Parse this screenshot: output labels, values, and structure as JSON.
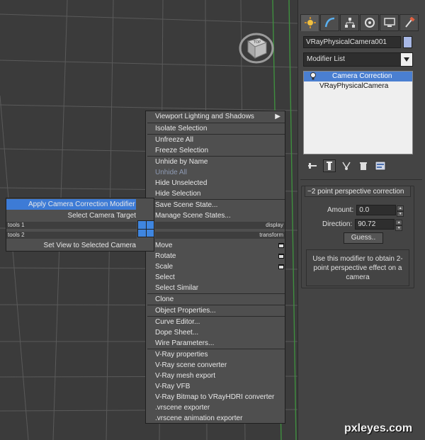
{
  "panel": {
    "object_name": "VRayPhysicalCamera001",
    "modifier_list": "Modifier List",
    "stack": [
      "Camera Correction",
      "VRayPhysicalCamera"
    ],
    "tabs": [
      "create-icon",
      "modify-icon",
      "hierarchy-icon",
      "motion-icon",
      "display-icon",
      "utilities-icon"
    ],
    "colors": {
      "object_color": "#a8b8e6",
      "stack_selection": "#4a7fd1"
    }
  },
  "rollout": {
    "title": "2 point perspective correction",
    "amount_label": "Amount:",
    "amount_value": "0.0",
    "direction_label": "Direction:",
    "direction_value": "90.72",
    "guess_button": "Guess..",
    "hint": "Use this modifier to obtain 2-point perspective effect on a camera"
  },
  "viewcube": {
    "label": "TOP"
  },
  "quad_right": {
    "display_header": "display",
    "transform_header": "transform",
    "display_items": [
      "Viewport Lighting and Shadows",
      "Isolate Selection",
      "Unfreeze All",
      "Freeze Selection",
      "Unhide by Name",
      "Unhide All",
      "Hide Unselected",
      "Hide Selection",
      "Save Scene State...",
      "Manage Scene States..."
    ],
    "transform_items": [
      "Move",
      "Rotate",
      "Scale",
      "Select",
      "Select Similar",
      "Clone",
      "Object Properties...",
      "Curve Editor...",
      "Dope Sheet...",
      "Wire Parameters...",
      "V-Ray properties",
      "V-Ray scene converter",
      "V-Ray mesh export",
      "V-Ray VFB",
      "V-Ray Bitmap to VRayHDRI converter",
      ".vrscene exporter",
      ".vrscene animation exporter"
    ]
  },
  "quad_left": {
    "tools1_header": "tools 1",
    "tools2_header": "tools 2",
    "tools1_items": [
      "Apply Camera Correction Modifier",
      "Select Camera Target"
    ],
    "tools2_items": [
      "Set View to Selected Camera"
    ]
  },
  "watermark": "pxleyes.com"
}
